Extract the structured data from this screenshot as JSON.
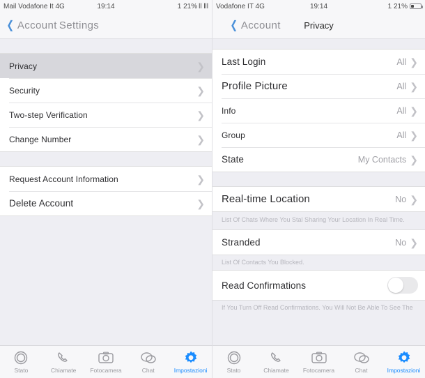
{
  "meta": {
    "accent_color": "#1a8cff",
    "back_chevron_color": "#4a90d9",
    "selected_row_color": "#d7d7dc",
    "page_background": "#eeeef3"
  },
  "left_screen": {
    "statusbar": {
      "carrier": "Mail Vodafone It 4G",
      "time": "19:14",
      "battery_text": "1 21%",
      "signal_text": "ll lll"
    },
    "navbar": {
      "back_label": "Account",
      "title": "Settings",
      "back_icon": "chevron-left-icon"
    },
    "sections": [
      {
        "rows": [
          {
            "label": "Privacy",
            "value": "",
            "selected": true,
            "disclosure": true
          },
          {
            "label": "Security",
            "value": "",
            "selected": false,
            "disclosure": true
          },
          {
            "label": "Two-step Verification",
            "value": "",
            "selected": false,
            "disclosure": true
          },
          {
            "label": "Change Number",
            "value": "",
            "selected": false,
            "disclosure": true
          }
        ]
      },
      {
        "rows": [
          {
            "label": "Request Account Information",
            "value": "",
            "selected": false,
            "disclosure": true
          },
          {
            "label": "Delete Account",
            "value": "",
            "selected": false,
            "disclosure": true
          }
        ]
      }
    ],
    "tabbar": {
      "items": [
        {
          "label": "Stato",
          "icon": "status-ring-icon",
          "active": false
        },
        {
          "label": "Chiamate",
          "icon": "phone-icon",
          "active": false
        },
        {
          "label": "Fotocamera",
          "icon": "camera-icon",
          "active": false
        },
        {
          "label": "Chat",
          "icon": "chat-bubbles-icon",
          "active": false
        },
        {
          "label": "Impostazioni",
          "icon": "gear-icon",
          "active": true
        }
      ]
    }
  },
  "right_screen": {
    "statusbar": {
      "carrier": "Vodafone IT 4G",
      "time": "19:14",
      "battery_text": "1 21%",
      "signal_text": ""
    },
    "navbar": {
      "back_label": "Account",
      "title": "Privacy",
      "back_icon": "chevron-left-icon"
    },
    "sections": [
      {
        "rows": [
          {
            "label": "Last Login",
            "value": "All",
            "disclosure": true
          },
          {
            "label": "Profile Picture",
            "value": "All",
            "disclosure": true
          },
          {
            "label": "Info",
            "value": "All",
            "disclosure": true
          },
          {
            "label": "Group",
            "value": "All",
            "disclosure": true
          },
          {
            "label": "State",
            "value": "My Contacts",
            "disclosure": true
          }
        ],
        "footnote": ""
      },
      {
        "rows": [
          {
            "label": "Real-time Location",
            "value": "No",
            "disclosure": true
          }
        ],
        "footnote": "List Of Chats Where You Stal Sharing Your Location In Real Time."
      },
      {
        "rows": [
          {
            "label": "Stranded",
            "value": "No",
            "disclosure": true
          }
        ],
        "footnote": "List Of Contacts You Blocked."
      },
      {
        "rows": [
          {
            "label": "Read Confirmations",
            "value": "",
            "toggle": true,
            "toggle_on": false
          }
        ],
        "footnote": "If You Turn Off Read Confirmations. You Will Not Be Able To See The"
      }
    ],
    "tabbar": {
      "items": [
        {
          "label": "Stato",
          "icon": "status-ring-icon",
          "active": false
        },
        {
          "label": "Chiamate",
          "icon": "phone-icon",
          "active": false
        },
        {
          "label": "Fotocamera",
          "icon": "camera-icon",
          "active": false
        },
        {
          "label": "Chat",
          "icon": "chat-bubbles-icon",
          "active": false
        },
        {
          "label": "Impostazioni",
          "icon": "gear-icon",
          "active": true
        }
      ]
    }
  }
}
